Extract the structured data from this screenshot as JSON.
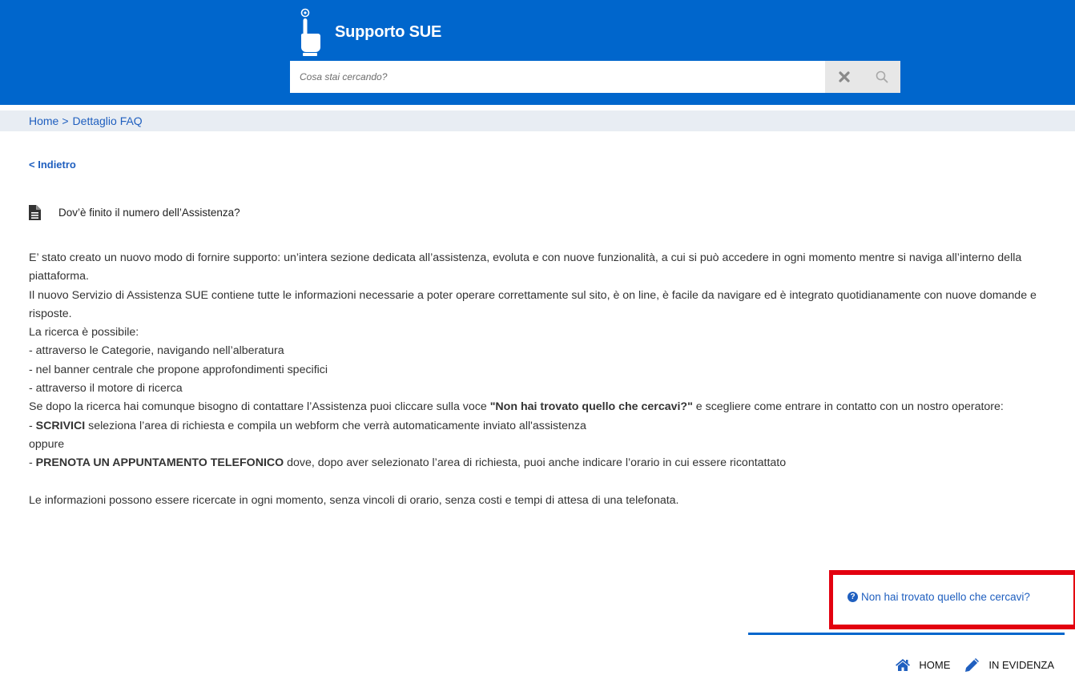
{
  "header": {
    "title": "Supporto SUE",
    "brand_color": "#0066cc",
    "icon": "hand-pointer-icon"
  },
  "search": {
    "placeholder": "Cosa stai cercando?",
    "value": "",
    "clear_icon": "times-icon",
    "search_icon": "search-icon"
  },
  "breadcrumb": {
    "home": "Home",
    "separator": ">",
    "current": "Dettaglio FAQ"
  },
  "back_link": "< Indietro",
  "faq": {
    "icon": "document-icon",
    "title": "Dov’è finito il numero dell’Assistenza?",
    "paragraphs": {
      "p1": "E’ stato creato un nuovo modo di fornire supporto: un’intera sezione dedicata all’assistenza, evoluta e con nuove funzionalità, a cui si può accedere in ogni momento mentre si naviga all’interno della piattaforma.",
      "p2": "Il nuovo Servizio di Assistenza SUE contiene tutte le informazioni necessarie a poter operare correttamente sul sito, è on line, è facile da navigare ed è integrato quotidianamente con nuove domande e risposte.",
      "p3": "La ricerca è possibile:",
      "b1": "- attraverso le Categorie, navigando nell’alberatura",
      "b2": "- nel banner centrale che propone approfondimenti specifici",
      "b3": "- attraverso il motore di ricerca",
      "p4_pre": "Se dopo la ricerca hai comunque bisogno di contattare l’Assistenza puoi cliccare sulla voce ",
      "p4_bold": "\"Non hai trovato quello che cercavi?\"",
      "p4_post": " e scegliere come entrare in contatto con un nostro operatore:",
      "s1_dash": "- ",
      "s1_bold": "SCRIVICI",
      "s1_text": " seleziona l’area di richiesta e compila un webform che verrà automaticamente inviato all'assistenza",
      "oppure": "oppure",
      "s2_dash": "- ",
      "s2_bold": "PRENOTA UN APPUNTAMENTO TELEFONICO",
      "s2_text": " dove, dopo aver selezionato l’area di richiesta, puoi anche indicare l’orario in cui essere ricontattato",
      "p5": "Le informazioni possono essere ricercate in ogni momento, senza vincoli di orario, senza costi e tempi di attesa di una telefonata."
    }
  },
  "not_found_link": "Non hai trovato quello che cercavi?",
  "not_found_icon": "question-circle-icon",
  "highlight_color": "#e3000f",
  "footer_nav": {
    "home": "HOME",
    "home_icon": "home-icon",
    "in_evidenza": "IN EVIDENZA",
    "in_evidenza_icon": "pencil-icon"
  }
}
